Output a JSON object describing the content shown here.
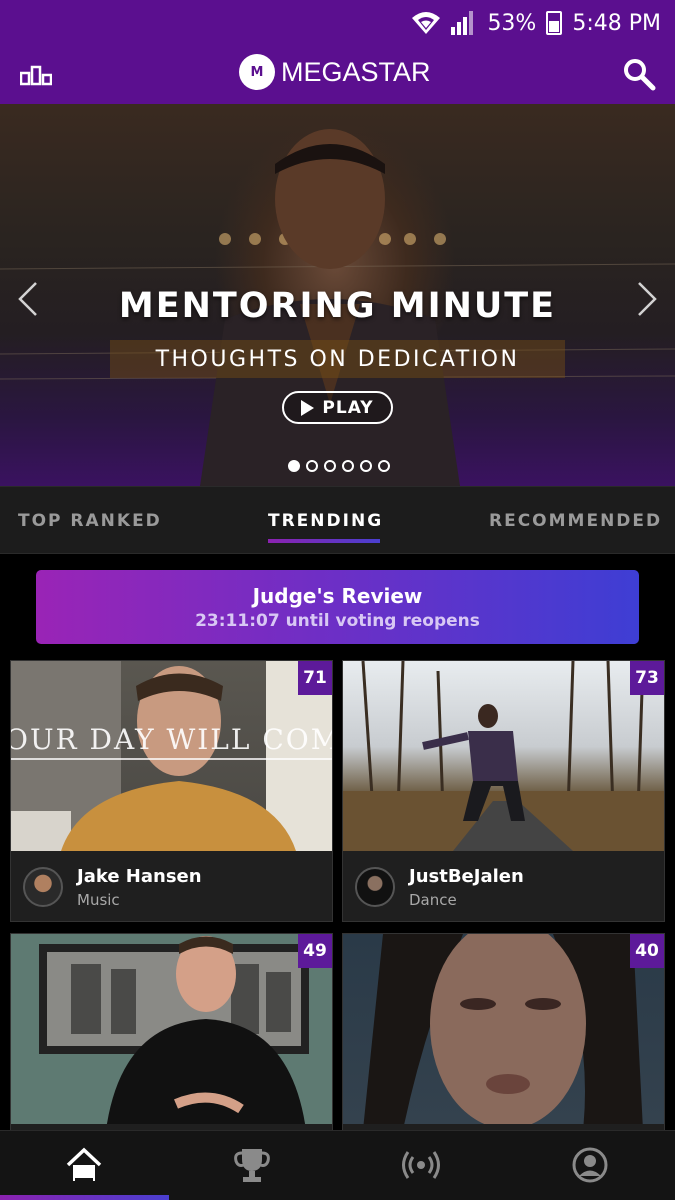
{
  "status_bar": {
    "battery": "53%",
    "time": "5:48 PM",
    "icons": [
      "wifi-icon",
      "signal-icon",
      "battery-icon"
    ]
  },
  "header": {
    "logo_badge": "M",
    "logo_text": "MEGASTAR",
    "left_icon": "ranking-icon",
    "right_icon": "search-icon"
  },
  "hero": {
    "title": "MENTORING MINUTE",
    "subtitle": "THOUGHTS ON DEDICATION",
    "play_label": "PLAY",
    "slide_count": 6,
    "active_slide": 1
  },
  "tabs": [
    {
      "label": "TOP RANKED",
      "active": false
    },
    {
      "label": "TRENDING",
      "active": true
    },
    {
      "label": "RECOMMENDED",
      "active": false
    }
  ],
  "review": {
    "title": "Judge's Review",
    "countdown": "23:11:07 until voting reopens"
  },
  "cards": [
    {
      "score": "71",
      "name": "Jake Hansen",
      "category": "Music",
      "overlay": "OUR DAY WILL COME"
    },
    {
      "score": "73",
      "name": "JustBeJalen",
      "category": "Dance"
    },
    {
      "score": "49"
    },
    {
      "score": "40"
    }
  ],
  "bottom_nav": {
    "items": [
      "home-icon",
      "trophy-icon",
      "live-icon",
      "profile-icon"
    ],
    "active": "home-icon"
  },
  "colors": {
    "brand_purple": "#5b0f8f",
    "gradient_start": "#9a24b6",
    "gradient_end": "#3e3ed4"
  }
}
